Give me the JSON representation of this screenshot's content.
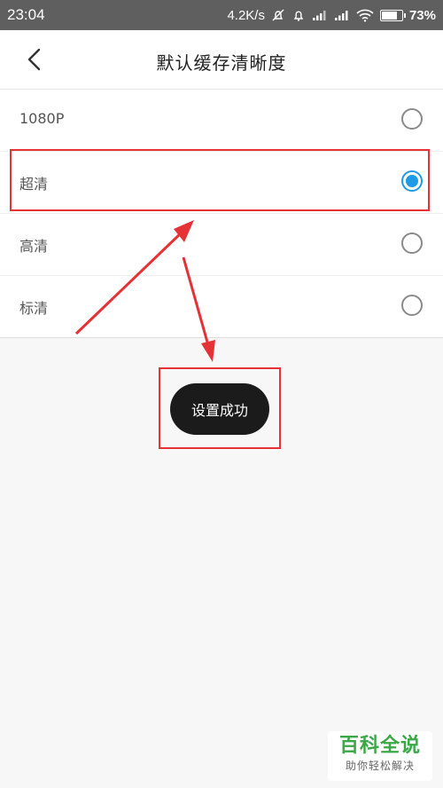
{
  "status_bar": {
    "time": "23:04",
    "net_speed": "4.2K/s",
    "battery_percent": "73%",
    "battery_level": 0.73,
    "icons": [
      "mute-icon",
      "alarm-icon",
      "signal-icon",
      "signal-icon",
      "wifi-icon",
      "battery-icon"
    ]
  },
  "header": {
    "title": "默认缓存清晰度",
    "back_icon": "chevron-left-icon"
  },
  "options": [
    {
      "label": "1080P",
      "selected": false
    },
    {
      "label": "超清",
      "selected": true
    },
    {
      "label": "高清",
      "selected": false
    },
    {
      "label": "标清",
      "selected": false
    }
  ],
  "toast": {
    "text": "设置成功"
  },
  "annotation": {
    "color": "#e53236"
  },
  "accent_color": "#1e9be7",
  "watermark": {
    "title": "百科全说",
    "subtitle": "助你轻松解决"
  }
}
